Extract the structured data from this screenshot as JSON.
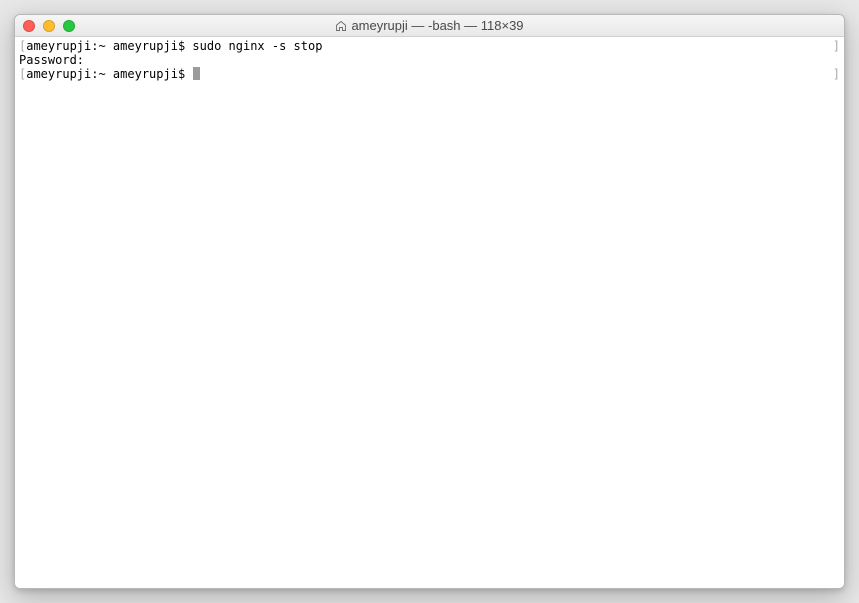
{
  "window": {
    "title": "ameyrupji — -bash — 118×39"
  },
  "terminal": {
    "lines": [
      {
        "left_bracket": "[",
        "prompt": "ameyrupji:~ ameyrupji$ ",
        "command": "sudo nginx -s stop",
        "right_bracket": "]"
      },
      {
        "left_bracket": "",
        "prompt": "Password:",
        "command": "",
        "right_bracket": ""
      },
      {
        "left_bracket": "[",
        "prompt": "ameyrupji:~ ameyrupji$ ",
        "command": "",
        "right_bracket": "]",
        "cursor": true
      }
    ]
  }
}
